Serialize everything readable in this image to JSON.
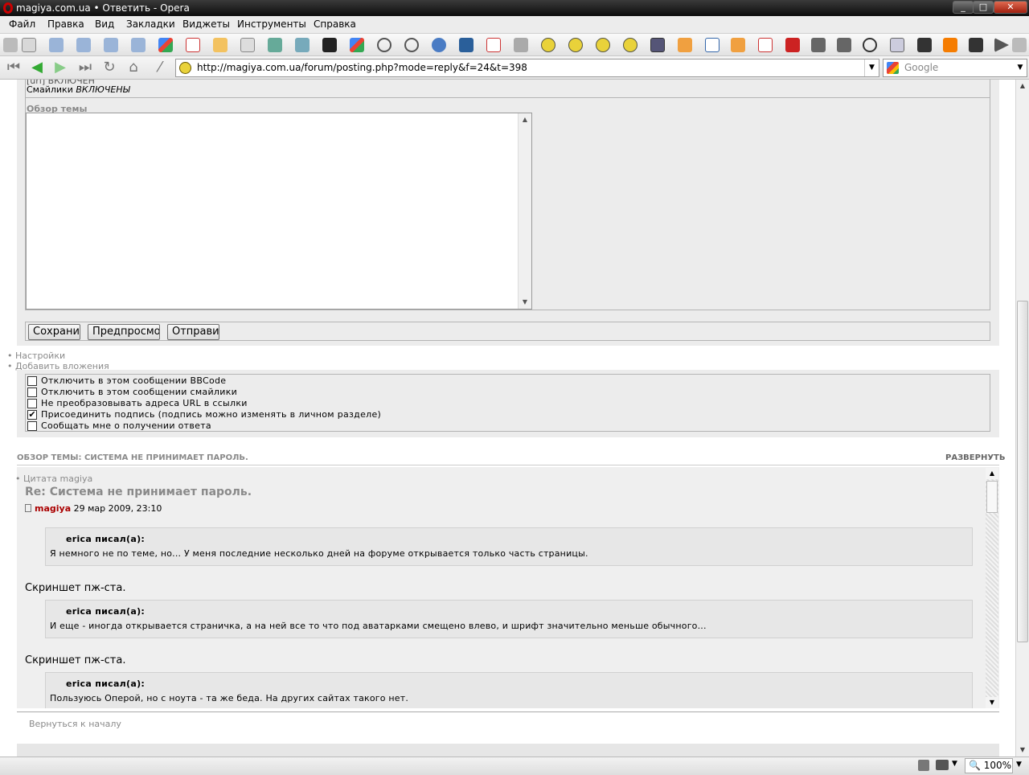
{
  "window": {
    "title": "magiya.com.ua • Ответить - Opera",
    "controls": [
      "minimize",
      "maximize",
      "close"
    ]
  },
  "menu": [
    "Файл",
    "Правка",
    "Вид",
    "Закладки",
    "Виджеты",
    "Инструменты",
    "Справка"
  ],
  "bookmarks_icons": [
    "page-icon",
    "google-icon",
    "amazon-icon",
    "pen-icon",
    "mail-icon",
    "rss-icon",
    "blogger-icon"
  ],
  "nav": {
    "address": "http://magiya.com.ua/forum/posting.php?mode=reply&f=24&t=398",
    "search_placeholder": "Google"
  },
  "form": {
    "smilies_label": "Смайлики",
    "smilies_value": "ВКЛЮЧЕНЫ",
    "review_label": "Обзор темы",
    "buttons": {
      "save": "Сохранить",
      "preview": "Предпросмотр",
      "submit": "Отправить"
    },
    "links": [
      "Настройки",
      "Добавить вложения"
    ],
    "options": [
      {
        "label": "Отключить в этом сообщении BBCode",
        "checked": false
      },
      {
        "label": "Отключить в этом сообщении смайлики",
        "checked": false
      },
      {
        "label": "Не преобразовывать адреса URL в ссылки",
        "checked": false
      },
      {
        "label": "Присоединить подпись (подпись можно изменять в личном разделе)",
        "checked": true
      },
      {
        "label": "Сообщать мне о получении ответа",
        "checked": false
      }
    ]
  },
  "review": {
    "header": "ОБЗОР ТЕМЫ: СИСТЕМА НЕ ПРИНИМАЕТ ПАРОЛЬ.",
    "expand": "РАЗВЕРНУТЬ",
    "quote_link": "Цитата magiya",
    "post_title": "Re: Система не принимает пароль.",
    "author": "magiya",
    "date": "29 мар 2009, 23:10",
    "quotes": [
      {
        "author": "erica писал(а):",
        "text": "Я немного не по теме, но... У меня последние несколько дней на форуме открывается только часть страницы."
      },
      {
        "author": "erica писал(а):",
        "text": "И еще - иногда открывается страничка, а на ней все то что под аватарками смещено влево, и шрифт значительно меньше обычного..."
      },
      {
        "author": "erica писал(а):",
        "text": "Пользуюсь Оперой, но с ноута - та же беда. На других сайтах такого нет."
      }
    ],
    "replies": [
      "Скриншет пж-ста.",
      "Скриншет пж-ста."
    ],
    "back_to_top": "Вернуться к началу"
  },
  "status": {
    "zoom": "100%"
  }
}
